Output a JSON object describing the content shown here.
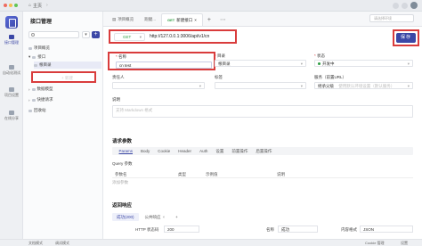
{
  "topbar": {
    "home_label": "主页"
  },
  "sidebar": {
    "items": [
      {
        "label": "接口管理",
        "active": true
      },
      {
        "label": "自动化测试",
        "active": false
      },
      {
        "label": "项目设置",
        "active": false
      },
      {
        "label": "在线分享",
        "active": false
      }
    ]
  },
  "tree": {
    "title": "接口管理",
    "filter_icon": "filter-icon",
    "add_label": "+",
    "items": [
      {
        "label": "项目概览"
      },
      {
        "label": "接口"
      },
      {
        "label": "根目录"
      },
      {
        "label": "数据模型"
      },
      {
        "label": "快捷请求"
      },
      {
        "label": "回收站"
      }
    ],
    "new_item_placeholder": "+ 新建"
  },
  "tabs": {
    "items": [
      {
        "label": "项目概览",
        "method": "",
        "active": false
      },
      {
        "label": "跑腿...",
        "method": "",
        "active": false
      },
      {
        "label": "新建接口",
        "method": "GET",
        "active": true
      }
    ],
    "plus": "+",
    "more": "⋯",
    "env_placeholder": "请选择环境"
  },
  "request": {
    "method": "GET",
    "url": "http://127.0.0.1:3006/api/v1/cn",
    "save_label": "保存"
  },
  "form": {
    "name_label": "名称",
    "name_value": "cn test",
    "dir_label": "目录",
    "dir_value": "根目录",
    "status_label": "状态",
    "status_value": "开发中",
    "owner_label": "责任人",
    "owner_placeholder": "",
    "tag_label": "标签",
    "tag_placeholder": "",
    "service_label": "服务（前置URL）",
    "service_value": "继承父级",
    "service_hint": "使用默认环境设置（默认服务）",
    "desc_label": "说明",
    "desc_placeholder": "支持 Markdown 格式"
  },
  "params": {
    "title": "请求参数",
    "tabs": [
      "Params",
      "Body",
      "Cookie",
      "Header",
      "Auth",
      "设置",
      "前置操作",
      "后置操作"
    ],
    "active_tab": "Params",
    "query_label": "Query 参数",
    "columns": [
      "参数名",
      "类型",
      "示例值",
      "说明"
    ],
    "add_label": "添加参数"
  },
  "response": {
    "title": "返回响应",
    "tabs": [
      {
        "label": "成功(200)",
        "active": true
      },
      {
        "label": "公共响应",
        "active": false
      }
    ],
    "add_label": "+",
    "status_label": "HTTP 状态码",
    "status_value": "200",
    "name_label": "名称",
    "name_value": "成功",
    "format_label": "内容格式",
    "format_value": "JSON"
  },
  "statusbar": {
    "left_1": "文档模式",
    "left_2": "调试模式",
    "right_1": "Cookie 管理",
    "right_2": "设置"
  }
}
